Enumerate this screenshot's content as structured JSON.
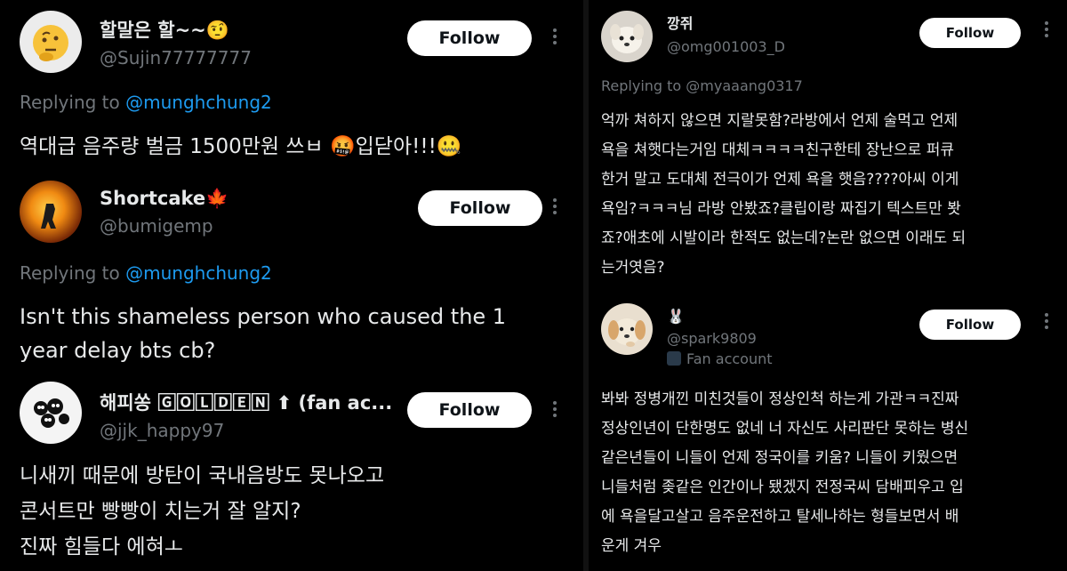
{
  "left": {
    "post1": {
      "display_name": "할말은 할~~🤨",
      "handle": "@Sujin77777777",
      "follow_label": "Follow",
      "replying_prefix": "Replying to ",
      "replying_handle": "@munghchung2",
      "body": "역대급 음주량 벌금 1500만원 쓰ㅂ 🤬입닫아!!!🤐"
    },
    "post2": {
      "display_name": "Shortcake🍁",
      "handle": "@bumigemp",
      "follow_label": "Follow",
      "replying_prefix": "Replying to ",
      "replying_handle": "@munghchung2",
      "body_lines": [
        "Isn't this shameless person who caused the 1",
        "year delay bts cb?"
      ]
    },
    "post3": {
      "display_name": "해피쏭 🄶🄾🄻🄳🄴🄽 ⬆ (fan ac...",
      "handle": "@jjk_happy97",
      "follow_label": "Follow",
      "body_lines": [
        "니새끼 때문에 방탄이 국내음방도 못나오고",
        "콘서트만 빵빵이 치는거 잘 알지?",
        "진짜 힘들다 에혀ㅗ"
      ]
    }
  },
  "right": {
    "post1": {
      "display_name": "깡쥐",
      "handle": "@omg001003_D",
      "follow_label": "Follow",
      "replying_prefix": "Replying to ",
      "replying_handle": "@myaaang0317",
      "body_lines": [
        "억까 쳐하지 않으면 지랄못함?라방에서 언제 술먹고 언제",
        "욕을 쳐햇다는거임 대체ㅋㅋㅋㅋ친구한테 장난으로 퍼큐",
        "한거 말고 도대체 전극이가 언제 욕을 햇음????아씨 이게",
        "욕임?ㅋㅋㅋ님 라방 안봤죠?클립이랑 짜집기 텍스트만 봣",
        "죠?애초에 시발이라 한적도 없는데?논란 없으면 이래도 되",
        "는거엿음?"
      ]
    },
    "post2": {
      "display_name": "🐰",
      "handle": "@spark9809",
      "badge": "Fan account",
      "follow_label": "Follow",
      "body_lines": [
        "봐봐 정병개낀 미친것들이 정상인척 하는게 가관ㅋㅋ진짜",
        "정상인년이 단한명도 없네 너 자신도 사리판단 못하는 병신",
        "같은년들이 니들이 언제 정국이를 키움? 니들이 키웠으면",
        "니들처럼 좆같은 인간이나 됐겠지 전정국씨  담배피우고 입",
        "에 욕을달고살고 음주운전하고 탈세나하는 형들보면서 배",
        "운게 겨우"
      ]
    }
  },
  "colors": {
    "background": "#000000",
    "text": "#e7e9ea",
    "muted": "#71767b",
    "mention": "#1d9bf0",
    "follow_bg": "#ffffff"
  },
  "icons": [
    "thinking-emoji-avatar",
    "fire-avatar",
    "soot-sprites-avatar",
    "puppy-avatar",
    "puppy-avatar-2",
    "more-icon",
    "fan-badge-icon"
  ]
}
